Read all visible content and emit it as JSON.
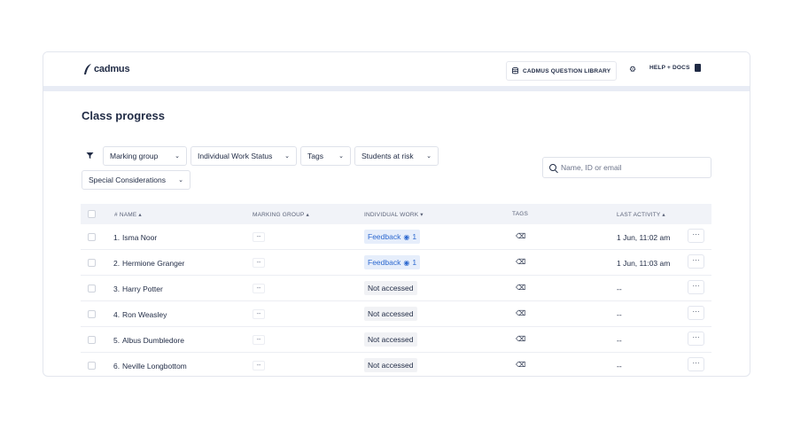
{
  "header": {
    "logo_text": "cadmus",
    "library_button": "CADMUS QUESTION LIBRARY",
    "help_link": "HELP + DOCS"
  },
  "page": {
    "title": "Class progress"
  },
  "filters": {
    "marking_group": "Marking group",
    "individual_work_status": "Individual Work Status",
    "tags": "Tags",
    "students_at_risk": "Students at risk",
    "special_considerations": "Special Considerations"
  },
  "search": {
    "placeholder": "Name, ID or email"
  },
  "table": {
    "columns": {
      "name": "# NAME",
      "marking_group": "MARKING GROUP",
      "individual_work": "INDIVIDUAL WORK",
      "tags": "TAGS",
      "last_activity": "LAST ACTIVITY"
    },
    "rows": [
      {
        "index": "1.",
        "name": "Isma Noor",
        "marking_group": "--",
        "work": "Feedback",
        "views": "1",
        "last_activity": "1 Jun, 11:02 am"
      },
      {
        "index": "2.",
        "name": "Hermione Granger",
        "marking_group": "--",
        "work": "Feedback",
        "views": "1",
        "last_activity": "1 Jun, 11:03 am"
      },
      {
        "index": "3.",
        "name": "Harry Potter",
        "marking_group": "--",
        "work": "Not accessed",
        "views": "",
        "last_activity": "--"
      },
      {
        "index": "4.",
        "name": "Ron Weasley",
        "marking_group": "--",
        "work": "Not accessed",
        "views": "",
        "last_activity": "--"
      },
      {
        "index": "5.",
        "name": "Albus Dumbledore",
        "marking_group": "--",
        "work": "Not accessed",
        "views": "",
        "last_activity": "--"
      },
      {
        "index": "6.",
        "name": "Neville Longbottom",
        "marking_group": "--",
        "work": "Not accessed",
        "views": "",
        "last_activity": "--"
      }
    ]
  },
  "colors": {
    "primary_text": "#1f2a44",
    "feedback_blue": "#2f6ad0",
    "header_band": "#e8ecf5"
  }
}
